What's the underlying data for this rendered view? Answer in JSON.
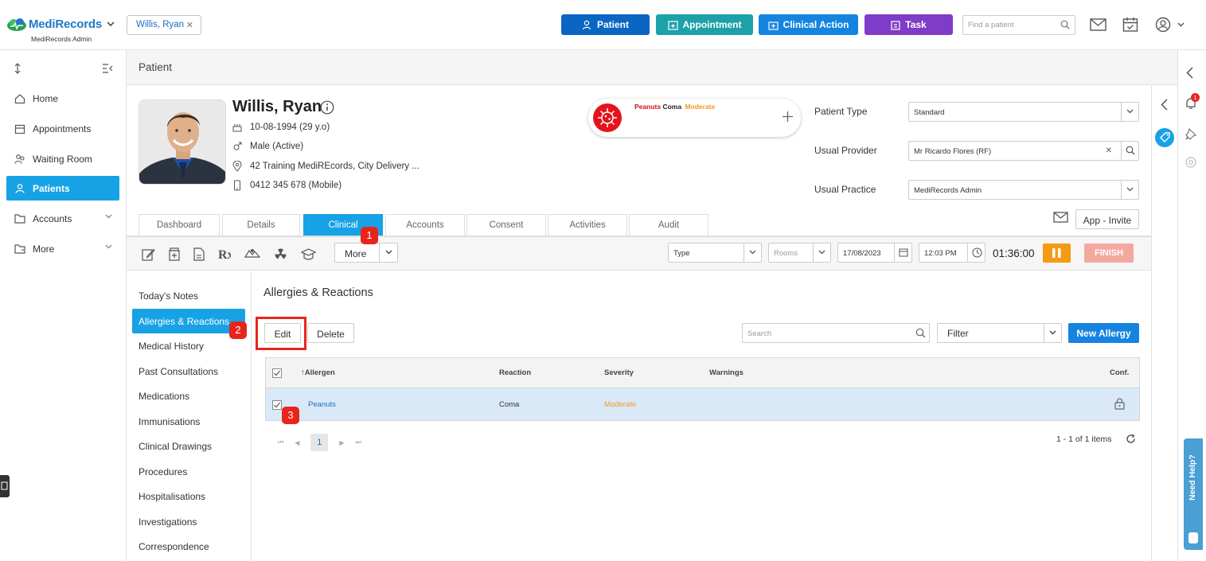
{
  "header": {
    "brand": "MediRecords",
    "brand_sub": "MediRecords Admin",
    "patient_tab": "Willis, Ryan",
    "buttons": {
      "patient": "Patient",
      "appointment": "Appointment",
      "clinical_action": "Clinical Action",
      "task": "Task"
    },
    "colors": {
      "patient": "#0a66c2",
      "appointment": "#1da1a9",
      "clinical_action": "#1584e0",
      "task": "#7e3cc9"
    },
    "find_placeholder": "Find a patient"
  },
  "sidebar": {
    "items": [
      {
        "label": "Home",
        "icon": "home-icon"
      },
      {
        "label": "Appointments",
        "icon": "calendar-icon"
      },
      {
        "label": "Waiting Room",
        "icon": "people-icon"
      },
      {
        "label": "Patients",
        "icon": "person-icon",
        "active": true
      },
      {
        "label": "Accounts",
        "icon": "folder-icon"
      },
      {
        "label": "More",
        "icon": "more-folder-icon"
      }
    ]
  },
  "page": {
    "title": "Patient"
  },
  "patient": {
    "name": "Willis, Ryan",
    "dob": "10-08-1994 (29 y.o)",
    "gender": "Male (Active)",
    "address": "42 Training MediREcords, City Delivery ...",
    "phone": "0412 345 678 (Mobile)"
  },
  "allergy_alert": {
    "allergen": "Peanuts",
    "reaction": "Coma",
    "severity": "Moderate"
  },
  "fields": {
    "patient_type_label": "Patient Type",
    "patient_type_value": "Standard",
    "usual_provider_label": "Usual Provider",
    "usual_provider_value": "Mr Ricardo Flores (RF)",
    "usual_practice_label": "Usual Practice",
    "usual_practice_value": "MediRecords Admin"
  },
  "tabs": [
    "Dashboard",
    "Details",
    "Clinical",
    "Accounts",
    "Consent",
    "Activities",
    "Audit"
  ],
  "app_invite": "App - Invite",
  "toolbar": {
    "more": "More",
    "type": "Type",
    "rooms": "Rooms",
    "date": "17/08/2023",
    "time": "12:03 PM",
    "timer": "01:36:00",
    "finish": "FINISH"
  },
  "clinical_nav": [
    "Today's Notes",
    "Allergies & Reactions",
    "Medical History",
    "Past Consultations",
    "Medications",
    "Immunisations",
    "Clinical Drawings",
    "Procedures",
    "Hospitalisations",
    "Investigations",
    "Correspondence"
  ],
  "section": {
    "title": "Allergies & Reactions",
    "edit": "Edit",
    "delete": "Delete",
    "search_placeholder": "Search",
    "filter": "Filter",
    "new_allergy": "New Allergy"
  },
  "table": {
    "headers": {
      "allergen": "↑Allergen",
      "reaction": "Reaction",
      "severity": "Severity",
      "warnings": "Warnings",
      "conf": "Conf."
    },
    "rows": [
      {
        "allergen": "Peanuts",
        "reaction": "Coma",
        "severity": "Moderate",
        "warnings": ""
      }
    ]
  },
  "pager": {
    "page": "1",
    "summary": "1 - 1 of 1 items"
  },
  "badges": [
    "1",
    "2",
    "3"
  ],
  "notifications": "1",
  "need_help": "Need Help?"
}
